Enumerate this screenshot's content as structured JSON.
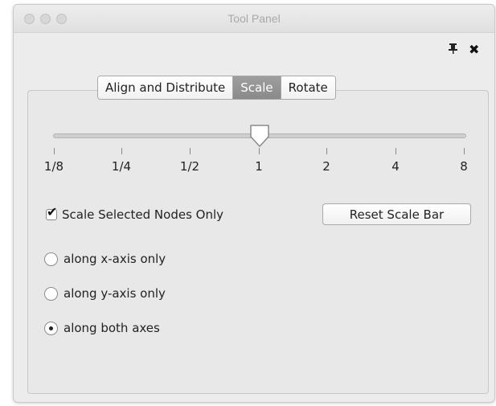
{
  "window": {
    "title": "Tool Panel"
  },
  "titlebar_icons": {
    "pin": "pin-icon",
    "close": "close-icon"
  },
  "tabs": [
    {
      "label": "Align and Distribute",
      "active": false
    },
    {
      "label": "Scale",
      "active": true
    },
    {
      "label": "Rotate",
      "active": false
    }
  ],
  "slider": {
    "ticks": [
      "1/8",
      "1/4",
      "1/2",
      "1",
      "2",
      "4",
      "8"
    ],
    "value": "1"
  },
  "checkbox": {
    "label": "Scale Selected Nodes Only",
    "checked": true
  },
  "reset_button": {
    "label": "Reset Scale Bar"
  },
  "radios": [
    {
      "label": "along x-axis only",
      "selected": false
    },
    {
      "label": "along y-axis only",
      "selected": false
    },
    {
      "label": "along both axes",
      "selected": true
    }
  ]
}
